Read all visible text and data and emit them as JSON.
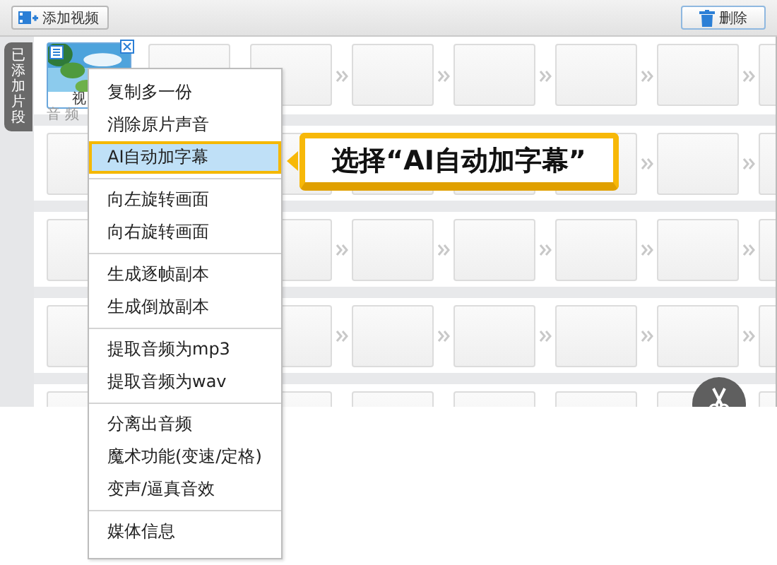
{
  "toolbar": {
    "add_button": "添加视频",
    "delete_button": "删除"
  },
  "side_tab": {
    "label": "已添加片段"
  },
  "clip": {
    "label": "视"
  },
  "audio_label": "音 频",
  "context_menu": [
    [
      {
        "label": "复制多一份",
        "selected": false
      },
      {
        "label": "消除原片声音",
        "selected": false
      },
      {
        "label": "AI自动加字幕",
        "selected": true
      }
    ],
    [
      {
        "label": "向左旋转画面",
        "selected": false
      },
      {
        "label": "向右旋转画面",
        "selected": false
      }
    ],
    [
      {
        "label": "生成逐帧副本",
        "selected": false
      },
      {
        "label": "生成倒放副本",
        "selected": false
      }
    ],
    [
      {
        "label": "提取音频为mp3",
        "selected": false
      },
      {
        "label": "提取音频为wav",
        "selected": false
      }
    ],
    [
      {
        "label": "分离出音频",
        "selected": false
      },
      {
        "label": "魔术功能(变速/定格)",
        "selected": false
      },
      {
        "label": "变声/逼真音效",
        "selected": false
      }
    ],
    [
      {
        "label": "媒体信息",
        "selected": false
      }
    ]
  ],
  "callout": {
    "text": "选择“AI自动加字幕”"
  }
}
